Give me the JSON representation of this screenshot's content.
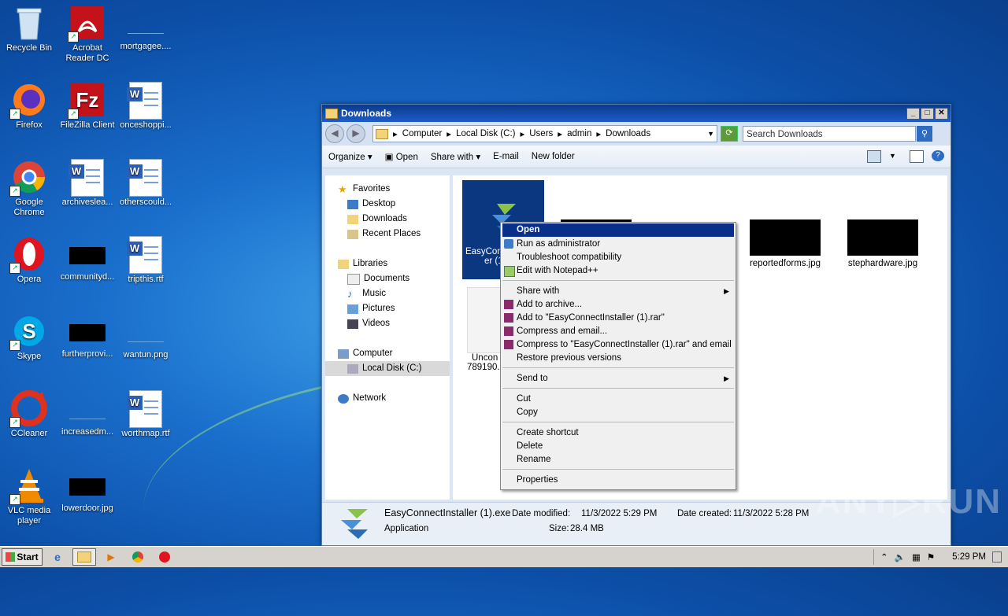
{
  "desktop": {
    "icons": [
      {
        "label": "Recycle Bin"
      },
      {
        "label": "Acrobat Reader DC"
      },
      {
        "label": "mortgagee...."
      },
      {
        "label": "Firefox"
      },
      {
        "label": "FileZilla Client"
      },
      {
        "label": "onceshoppi..."
      },
      {
        "label": "Google Chrome"
      },
      {
        "label": "archiveslea..."
      },
      {
        "label": "otherscould..."
      },
      {
        "label": "Opera"
      },
      {
        "label": "communityd..."
      },
      {
        "label": "tripthis.rtf"
      },
      {
        "label": "Skype"
      },
      {
        "label": "furtherprovi..."
      },
      {
        "label": "wantun.png"
      },
      {
        "label": "CCleaner"
      },
      {
        "label": "increasedm..."
      },
      {
        "label": "worthmap.rtf"
      },
      {
        "label": "VLC media player"
      },
      {
        "label": "lowerdoor.jpg"
      }
    ]
  },
  "window": {
    "title": "Downloads",
    "controls": {
      "minimize": "_",
      "maximize": "□",
      "close": "✕"
    },
    "address": {
      "crumbs": [
        "Computer",
        "Local Disk (C:)",
        "Users",
        "admin",
        "Downloads"
      ],
      "separator": "▸"
    },
    "search_placeholder": "Search Downloads",
    "toolbar": {
      "organize": "Organize",
      "open": "Open",
      "share_with": "Share with",
      "email": "E-mail",
      "new_folder": "New folder"
    },
    "nav": {
      "favorites": "Favorites",
      "desktop": "Desktop",
      "downloads": "Downloads",
      "recent_places": "Recent Places",
      "libraries": "Libraries",
      "documents": "Documents",
      "music": "Music",
      "pictures": "Pictures",
      "videos": "Videos",
      "computer": "Computer",
      "local_disk": "Local Disk (C:)",
      "network": "Network"
    },
    "files": {
      "installer_line1": "EasyCon",
      "installer_line2": "er (1",
      "uncon_line1": "Uncon",
      "uncon_line2": "789190.c",
      "reportedforms": "reportedforms.jpg",
      "stephardware": "stephardware.jpg"
    },
    "details": {
      "name": "EasyConnectInstaller (1).exe",
      "type": "Application",
      "date_modified_label": "Date modified:",
      "date_modified": "11/3/2022 5:29 PM",
      "size_label": "Size:",
      "size": "28.4 MB",
      "date_created_label": "Date created:",
      "date_created": "11/3/2022 5:28 PM"
    }
  },
  "context_menu": {
    "open": "Open",
    "run_as_admin": "Run as administrator",
    "troubleshoot": "Troubleshoot compatibility",
    "edit_notepad": "Edit with Notepad++",
    "share_with": "Share with",
    "add_archive": "Add to archive...",
    "add_rar": "Add to \"EasyConnectInstaller (1).rar\"",
    "compress_email": "Compress and email...",
    "compress_rar_email": "Compress to \"EasyConnectInstaller (1).rar\" and email",
    "restore": "Restore previous versions",
    "send_to": "Send to",
    "cut": "Cut",
    "copy": "Copy",
    "create_shortcut": "Create shortcut",
    "delete": "Delete",
    "rename": "Rename",
    "properties": "Properties"
  },
  "taskbar": {
    "start": "Start",
    "clock": "5:29 PM"
  },
  "watermark": "ANY▷RUN",
  "colors": {
    "selection": "#0a2f8a",
    "titlebar": "#0b3a8c"
  }
}
